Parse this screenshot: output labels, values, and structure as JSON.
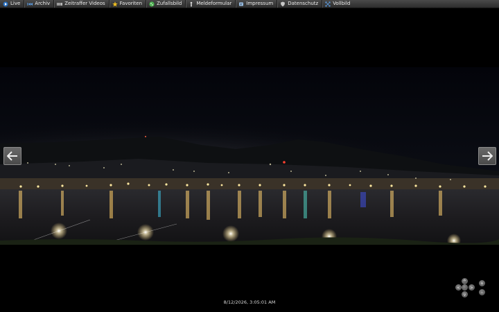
{
  "menu": {
    "items": [
      {
        "label": "Live",
        "icon": "live-play-icon"
      },
      {
        "label": "Archiv",
        "icon": "archive-rewind-icon"
      },
      {
        "label": "Zeitraffer Videos",
        "icon": "film-strip-icon"
      },
      {
        "label": "Favoriten",
        "icon": "star-icon"
      },
      {
        "label": "Zufallsbild",
        "icon": "random-dice-icon"
      },
      {
        "label": "Meldeformular",
        "icon": "person-form-icon"
      },
      {
        "label": "Impressum",
        "icon": "document-icon"
      },
      {
        "label": "Datenschutz",
        "icon": "shield-icon"
      },
      {
        "label": "Vollbild",
        "icon": "fullscreen-expand-icon"
      }
    ]
  },
  "viewer": {
    "timestamp": "8/12/2026, 3:05:01 AM",
    "prev_icon": "arrow-left-icon",
    "next_icon": "arrow-right-icon"
  },
  "controls": {
    "up": "^",
    "down": "v",
    "left": "<",
    "right": ">",
    "zoom_in": "+",
    "zoom_out": "−"
  },
  "colors": {
    "menubar": "#3a3a3a",
    "background": "#000000",
    "star": "#f0c020"
  }
}
